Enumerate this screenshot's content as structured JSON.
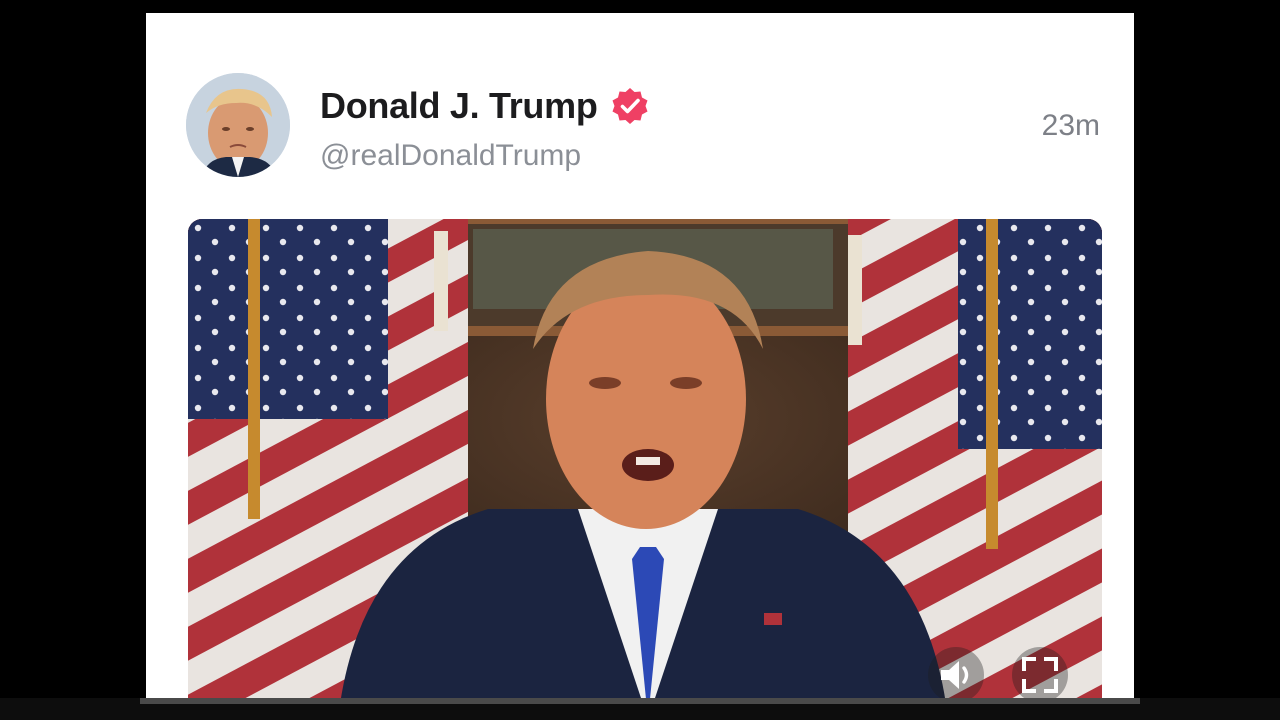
{
  "post": {
    "author": {
      "display_name": "Donald J. Trump",
      "handle": "@realDonaldTrump",
      "verified": true,
      "verified_color": "#ef4064",
      "avatar_icon": "profile-photo"
    },
    "timestamp": "23m",
    "media": {
      "type": "video",
      "controls": {
        "mute_icon": "speaker-icon",
        "fullscreen_icon": "fullscreen-icon"
      }
    }
  },
  "colors": {
    "background": "#000000",
    "card": "#ffffff",
    "name_text": "#1c1c1e",
    "secondary_text": "#8b8f96"
  }
}
